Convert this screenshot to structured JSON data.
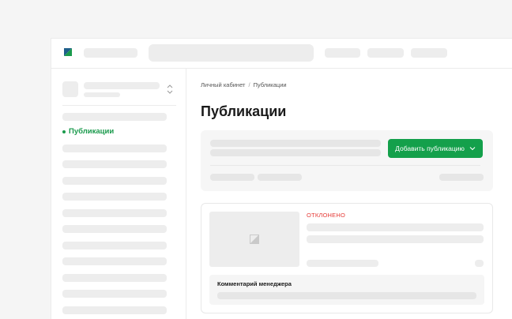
{
  "colors": {
    "accent": "#14a04b",
    "active_nav": "#1a9a4c",
    "status_rejected": "#e53935",
    "skeleton": "#ededed"
  },
  "icons": {
    "logo": "logo-icon",
    "sidebar_chevrons": "chevron-up-down-icon",
    "button_chevron": "chevron-down-icon",
    "thumbnail": "image-placeholder-icon"
  },
  "sidebar": {
    "active_item": {
      "label": "Публикации"
    }
  },
  "main": {
    "breadcrumb": {
      "items": [
        "Личный кабинет",
        "Публикации"
      ],
      "separator": "/"
    },
    "page_title": "Публикации",
    "filters": {
      "add_button_label": "Добавить публикацию"
    },
    "publication_card": {
      "status": "ОТКЛОНЕНО",
      "comment_title": "Комментарий менеджера"
    }
  }
}
